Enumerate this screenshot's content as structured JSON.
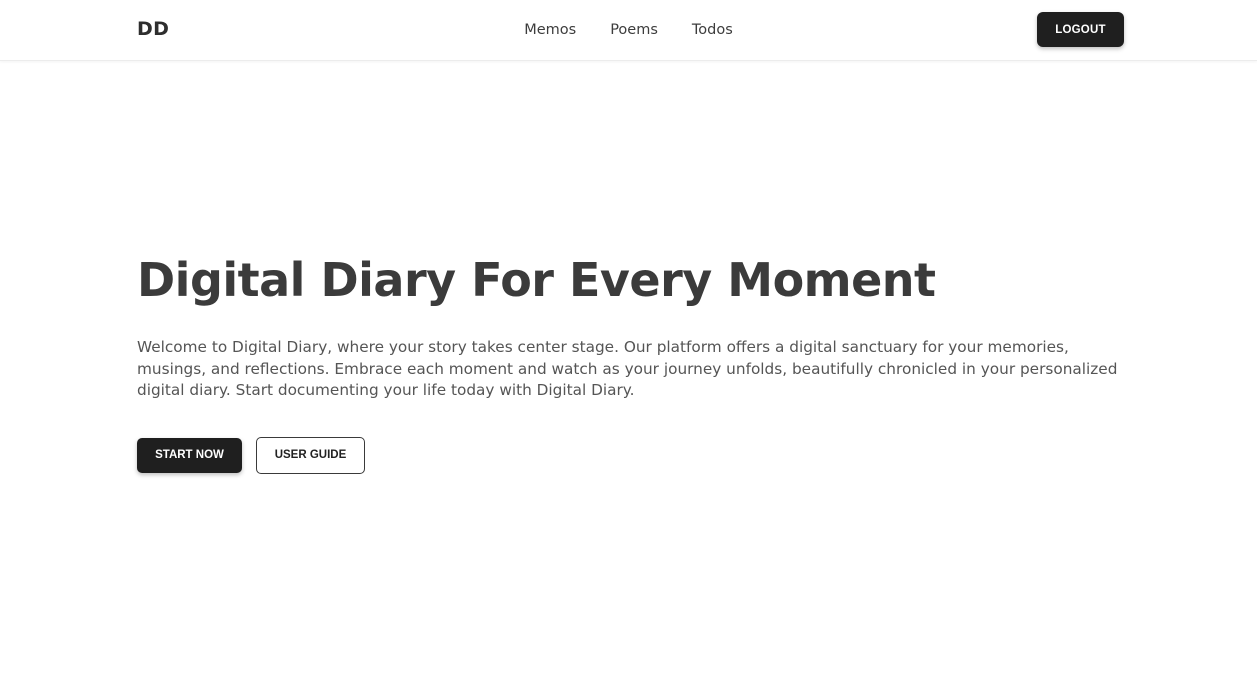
{
  "navbar": {
    "brand": "DD",
    "links": [
      {
        "label": "Memos"
      },
      {
        "label": "Poems"
      },
      {
        "label": "Todos"
      }
    ],
    "logout_label": "LOGOUT"
  },
  "hero": {
    "title": "Digital Diary For Every Moment",
    "description": "Welcome to Digital Diary, where your story takes center stage. Our platform offers a digital sanctuary for your memories, musings, and reflections. Embrace each moment and watch as your journey unfolds, beautifully chronicled in your personalized digital diary. Start documenting your life today with Digital Diary.",
    "primary_button": "START NOW",
    "secondary_button": "USER GUIDE"
  },
  "colors": {
    "background": "#ffffff",
    "dark_button": "#1f1f1f",
    "heading_text": "#3b3b3b",
    "body_text": "#555555"
  }
}
